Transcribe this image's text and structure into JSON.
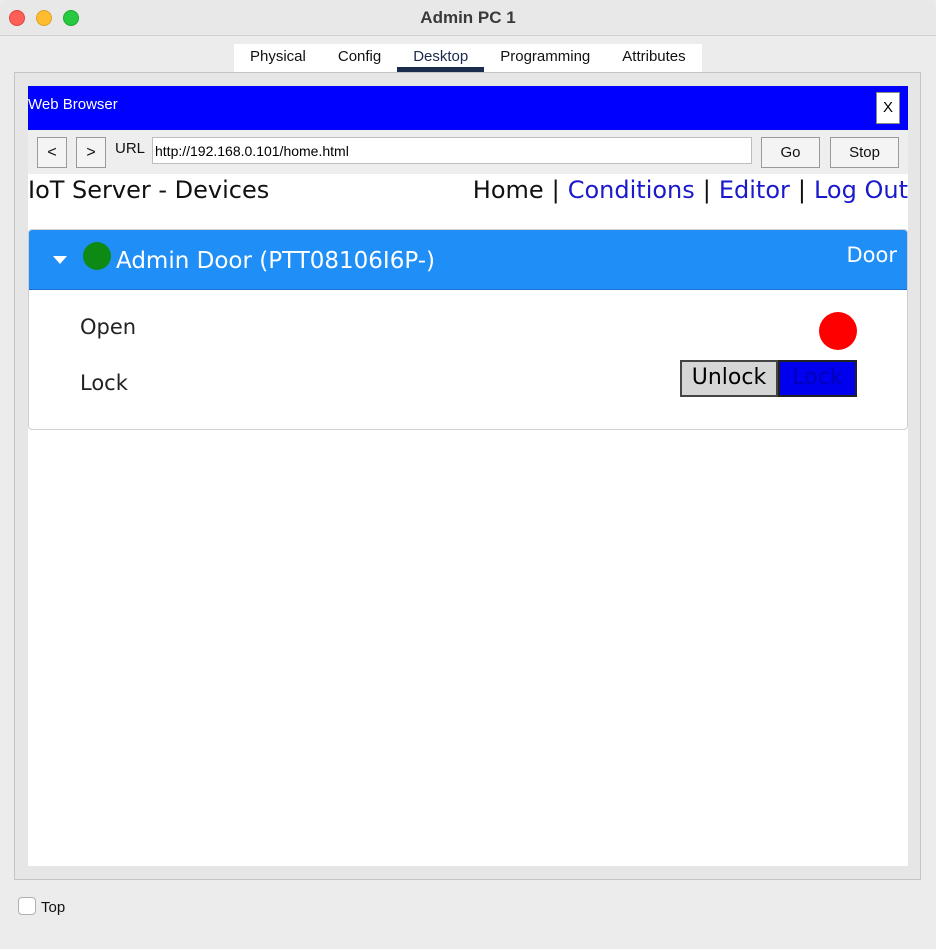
{
  "window": {
    "title": "Admin PC 1"
  },
  "tabs": [
    {
      "label": "Physical"
    },
    {
      "label": "Config"
    },
    {
      "label": "Desktop",
      "active": true
    },
    {
      "label": "Programming"
    },
    {
      "label": "Attributes"
    }
  ],
  "browser": {
    "title": "Web Browser",
    "close_label": "X",
    "back_label": "<",
    "forward_label": ">",
    "url_label": "URL",
    "url_value": "http://192.168.0.101/home.html",
    "go_label": "Go",
    "stop_label": "Stop"
  },
  "page": {
    "title": "IoT Server - Devices",
    "nav": {
      "home": "Home",
      "conditions": "Conditions",
      "editor": "Editor",
      "logout": "Log Out",
      "separator": "|"
    }
  },
  "device": {
    "name": "Admin Door (PTT08106I6P-)",
    "type": "Door",
    "status_color": "#0c8a14",
    "header_color": "#1f8ff7",
    "rows": {
      "open_label": "Open",
      "open_indicator_color": "#ff0000",
      "lock_label": "Lock",
      "unlock_button": "Unlock",
      "lock_button": "Lock"
    }
  },
  "footer": {
    "top_label": "Top",
    "top_checked": false
  }
}
